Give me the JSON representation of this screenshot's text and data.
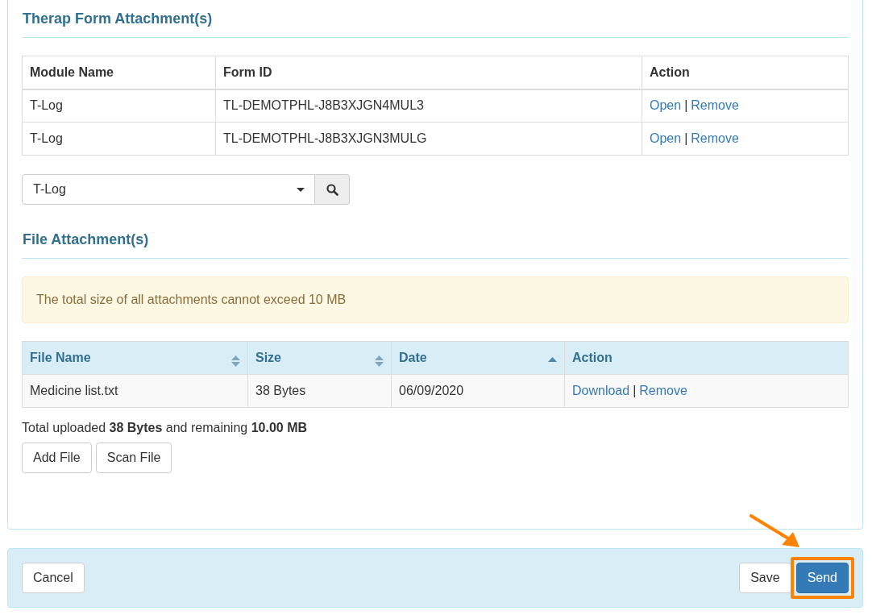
{
  "form_attachments": {
    "title": "Therap Form Attachment(s)",
    "columns": [
      "Module Name",
      "Form ID",
      "Action"
    ],
    "rows": [
      {
        "module": "T-Log",
        "form_id": "TL-DEMOTPHL-J8B3XJGN4MUL3",
        "actions": [
          "Open",
          "Remove"
        ],
        "separator": "|"
      },
      {
        "module": "T-Log",
        "form_id": "TL-DEMOTPHL-J8B3XJGN3MULG",
        "actions": [
          "Open",
          "Remove"
        ],
        "separator": "|"
      }
    ],
    "module_select": {
      "value": "T-Log"
    }
  },
  "file_attachments": {
    "title": "File Attachment(s)",
    "notice": "The total size of all attachments cannot exceed 10 MB",
    "columns": [
      {
        "label": "File Name",
        "sortable": true,
        "sorted": false
      },
      {
        "label": "Size",
        "sortable": true,
        "sorted": false
      },
      {
        "label": "Date",
        "sortable": true,
        "sorted": true
      },
      {
        "label": "Action",
        "sortable": false,
        "sorted": false
      }
    ],
    "rows": [
      {
        "file_name": "Medicine list.txt",
        "size": "38 Bytes",
        "date": "06/09/2020",
        "actions": [
          "Download",
          "Remove"
        ],
        "separator": "|"
      }
    ],
    "summary": "Total uploaded **38 Bytes** and remaining **10.00 MB**",
    "buttons": [
      "Add File",
      "Scan File"
    ]
  },
  "footer": {
    "left_buttons": [
      {
        "label": "Cancel",
        "kind": "default",
        "highlighted": false
      }
    ],
    "right_buttons": [
      {
        "label": "Save",
        "kind": "default",
        "highlighted": false
      },
      {
        "label": "Send",
        "kind": "primary",
        "highlighted": true
      }
    ]
  }
}
